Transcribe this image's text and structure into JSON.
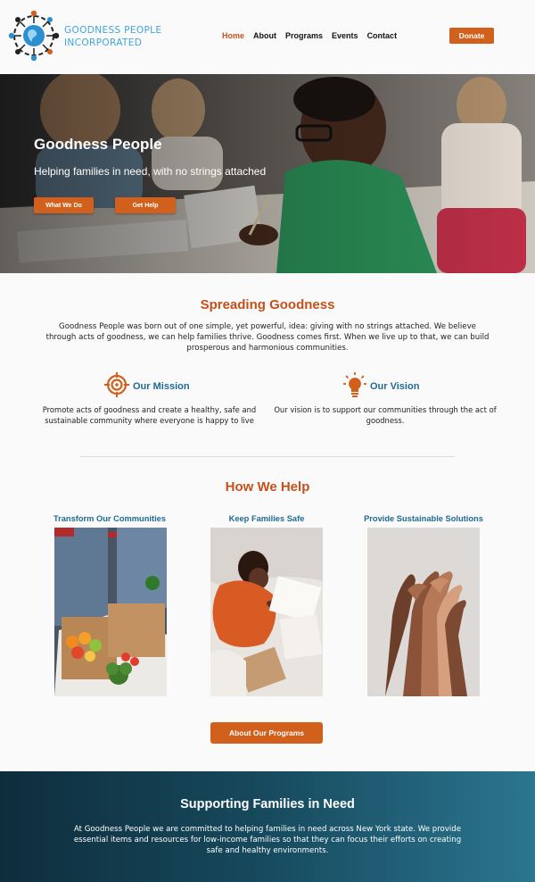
{
  "header": {
    "logo_line1": "GOODNESS PEOPLE",
    "logo_line2": "INCORPORATED",
    "nav": [
      "Home",
      "About",
      "Programs",
      "Events",
      "Contact"
    ],
    "active_nav": "Home",
    "donate_label": "Donate"
  },
  "hero": {
    "title": "Goodness People",
    "subtitle": "Helping families in need, with no strings attached",
    "button_what": "What We Do",
    "button_help": "Get Help"
  },
  "spreading": {
    "title": "Spreading Goodness",
    "text": "Goodness People was born out of one simple, yet powerful, idea: giving with no strings attached. We believe through acts of goodness, we can help families thrive. Goodness comes first. When we live up to that, we can build prosperous and harmonious communities."
  },
  "mission": {
    "title": "Our Mission",
    "text": "Promote acts of goodness and create a healthy, safe and sustainable community where everyone is happy to live"
  },
  "vision": {
    "title": "Our Vision",
    "text": "Our vision is to support our communities through the act of goodness."
  },
  "how": {
    "title": "How We Help",
    "cards": [
      {
        "title": "Transform Our Communities"
      },
      {
        "title": "Keep Families Safe"
      },
      {
        "title": "Provide Sustainable Solutions"
      }
    ],
    "programs_label": "About Our Programs"
  },
  "band": {
    "title": "Supporting Families in Need",
    "text": "At Goodness People we are committed to helping families in need across New York state. We provide essential items and resources for low-income families so that they can focus their efforts on creating safe and healthy environments."
  },
  "colors": {
    "accent": "#d2601d",
    "heading_orange": "#c4511b",
    "heading_blue": "#1f6a93",
    "logo_blue": "#3fa6db"
  }
}
